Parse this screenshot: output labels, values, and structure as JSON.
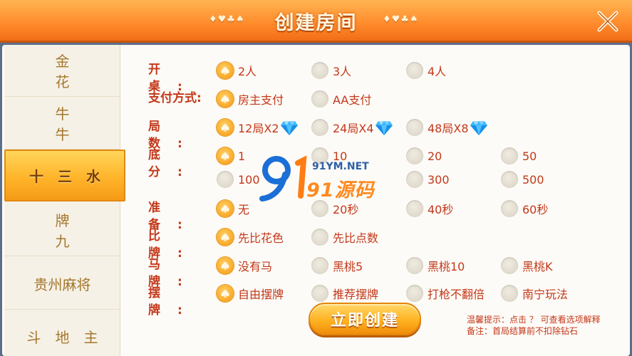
{
  "header": {
    "title": "创建房间",
    "decoration": "♦♥♣♠"
  },
  "sidebar": {
    "items": [
      {
        "label": "金花"
      },
      {
        "label": "牛牛"
      },
      {
        "label": "十三水"
      },
      {
        "label": "牌九"
      },
      {
        "label": "贵州麻将"
      },
      {
        "label": "斗地主"
      }
    ],
    "active_index": 2
  },
  "rows": [
    {
      "label": "开桌:",
      "options": [
        "2人",
        "3人",
        "4人"
      ],
      "selected": 0
    },
    {
      "label": "支付方式:",
      "options": [
        "房主支付",
        "AA支付"
      ],
      "selected": 0
    },
    {
      "label": "局数:",
      "options": [
        "12局X2",
        "24局X4",
        "48局X8"
      ],
      "selected": 0
    },
    {
      "label": "底分:",
      "options": [
        "1",
        "10",
        "20",
        "50",
        "100",
        "300",
        "500"
      ],
      "selected": 0
    },
    {
      "label": "准备:",
      "options": [
        "无",
        "20秒",
        "40秒",
        "60秒"
      ],
      "selected": 0
    },
    {
      "label": "比牌:",
      "options": [
        "先比花色",
        "先比点数"
      ],
      "selected": 0
    },
    {
      "label": "马牌:",
      "options": [
        "没有马",
        "黑桃5",
        "黑桃10",
        "黑桃K"
      ],
      "selected": 0
    },
    {
      "label": "摆牌:",
      "options": [
        "自由摆牌",
        "推荐摆牌",
        "打枪不翻倍",
        "南宁玩法"
      ],
      "selected": 0
    }
  ],
  "create_button": "立即创建",
  "tips": {
    "line1": "温馨提示：点击 ？ 可查看选项解释",
    "line2": "备注：首局结算前不扣除钻石"
  },
  "watermark": {
    "url": "91YM.NET",
    "name": "91源码"
  },
  "colors": {
    "accent": "#ff8a2b",
    "label": "#c3381a",
    "sidebar_text": "#a4772e"
  }
}
